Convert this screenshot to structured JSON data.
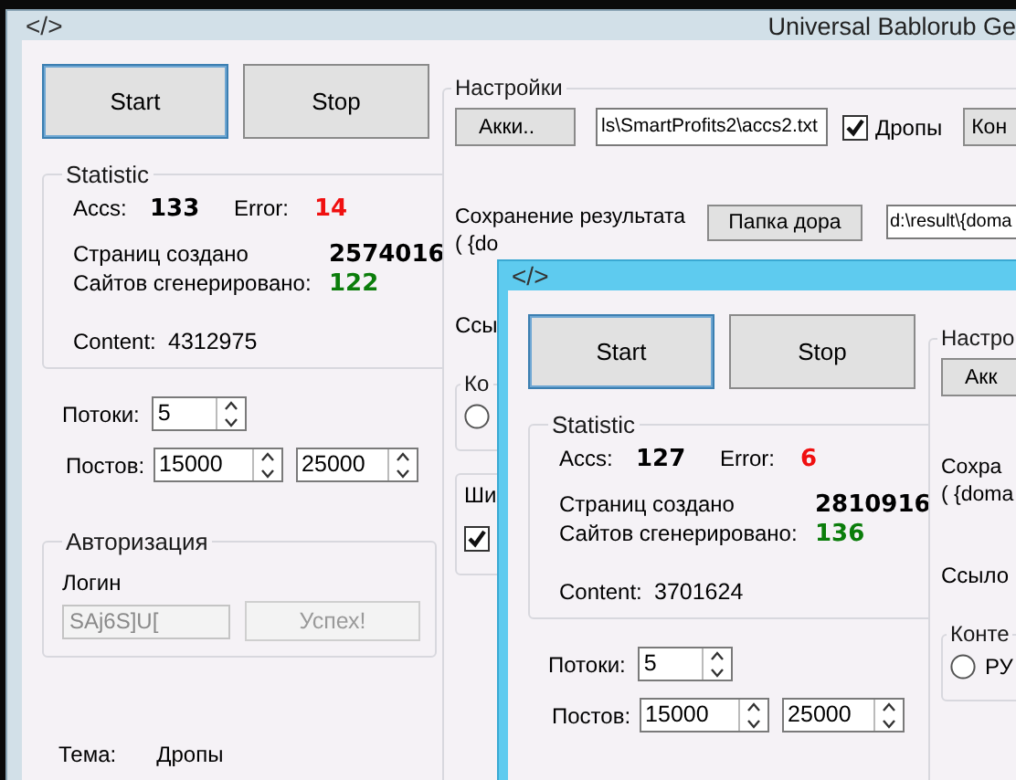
{
  "windows": [
    {
      "title": "Universal Bablorub Ge",
      "active": false,
      "icon": "</>",
      "buttons": [
        {
          "label": "Start",
          "focused": true
        },
        {
          "label": "Stop",
          "focused": false
        }
      ],
      "statistic": {
        "title": "Statistic",
        "accs_label": "Accs:",
        "accs": "133",
        "error_label": "Error:",
        "error": "14",
        "pages_label": "Страниц создано",
        "pages": "2574016",
        "sites_label": "Сайтов сгенерировано:",
        "sites": "122",
        "content_label": "Content:",
        "content": "4312975"
      },
      "threads": {
        "label": "Потоки:",
        "value": "5"
      },
      "posts": {
        "label": "Постов:",
        "min": "15000",
        "max": "25000"
      },
      "auth": {
        "title": "Авторизация",
        "login_label": "Логин",
        "login": "SAj6S]U[",
        "login_disabled": true,
        "button": "Успех!",
        "button_disabled": true
      },
      "theme": {
        "label": "Тема:",
        "value": "Дропы"
      },
      "settings": {
        "title": "Настройки",
        "accounts_button": "Акки..",
        "accounts_path": "ls\\SmartProfits2\\accs2.txt",
        "drops": {
          "label": "Дропы",
          "checked": true
        },
        "extra_button": "Кон",
        "save_lines": [
          "Сохранение результата",
          "( {do"
        ],
        "folder_button": "Папка дора",
        "folder_path": "d:\\result\\{doma",
        "link_label": "Ссы",
        "groups": [
          {
            "title": "Ко",
            "kind": "radio",
            "selected": false
          },
          {
            "title": "Ши",
            "kind": "checkbox",
            "checked": true
          }
        ]
      }
    },
    {
      "active": true,
      "icon": "</>",
      "buttons": [
        {
          "label": "Start",
          "focused": true
        },
        {
          "label": "Stop",
          "focused": false
        }
      ],
      "statistic": {
        "title": "Statistic",
        "accs_label": "Accs:",
        "accs": "127",
        "error_label": "Error:",
        "error": "6",
        "pages_label": "Страниц создано",
        "pages": "2810916",
        "sites_label": "Сайтов сгенерировано:",
        "sites": "136",
        "content_label": "Content:",
        "content": "3701624"
      },
      "threads": {
        "label": "Потоки:",
        "value": "5"
      },
      "posts": {
        "label": "Постов:",
        "min": "15000",
        "max": "25000"
      },
      "settings": {
        "title": "Настро",
        "accounts_button": "Акк",
        "save_lines": [
          "Сохра",
          "( {doma"
        ],
        "link_label": "Ссыло",
        "groups": [
          {
            "title": "Конте",
            "kind": "radio",
            "selected": false,
            "label": "РУ"
          }
        ]
      }
    }
  ]
}
